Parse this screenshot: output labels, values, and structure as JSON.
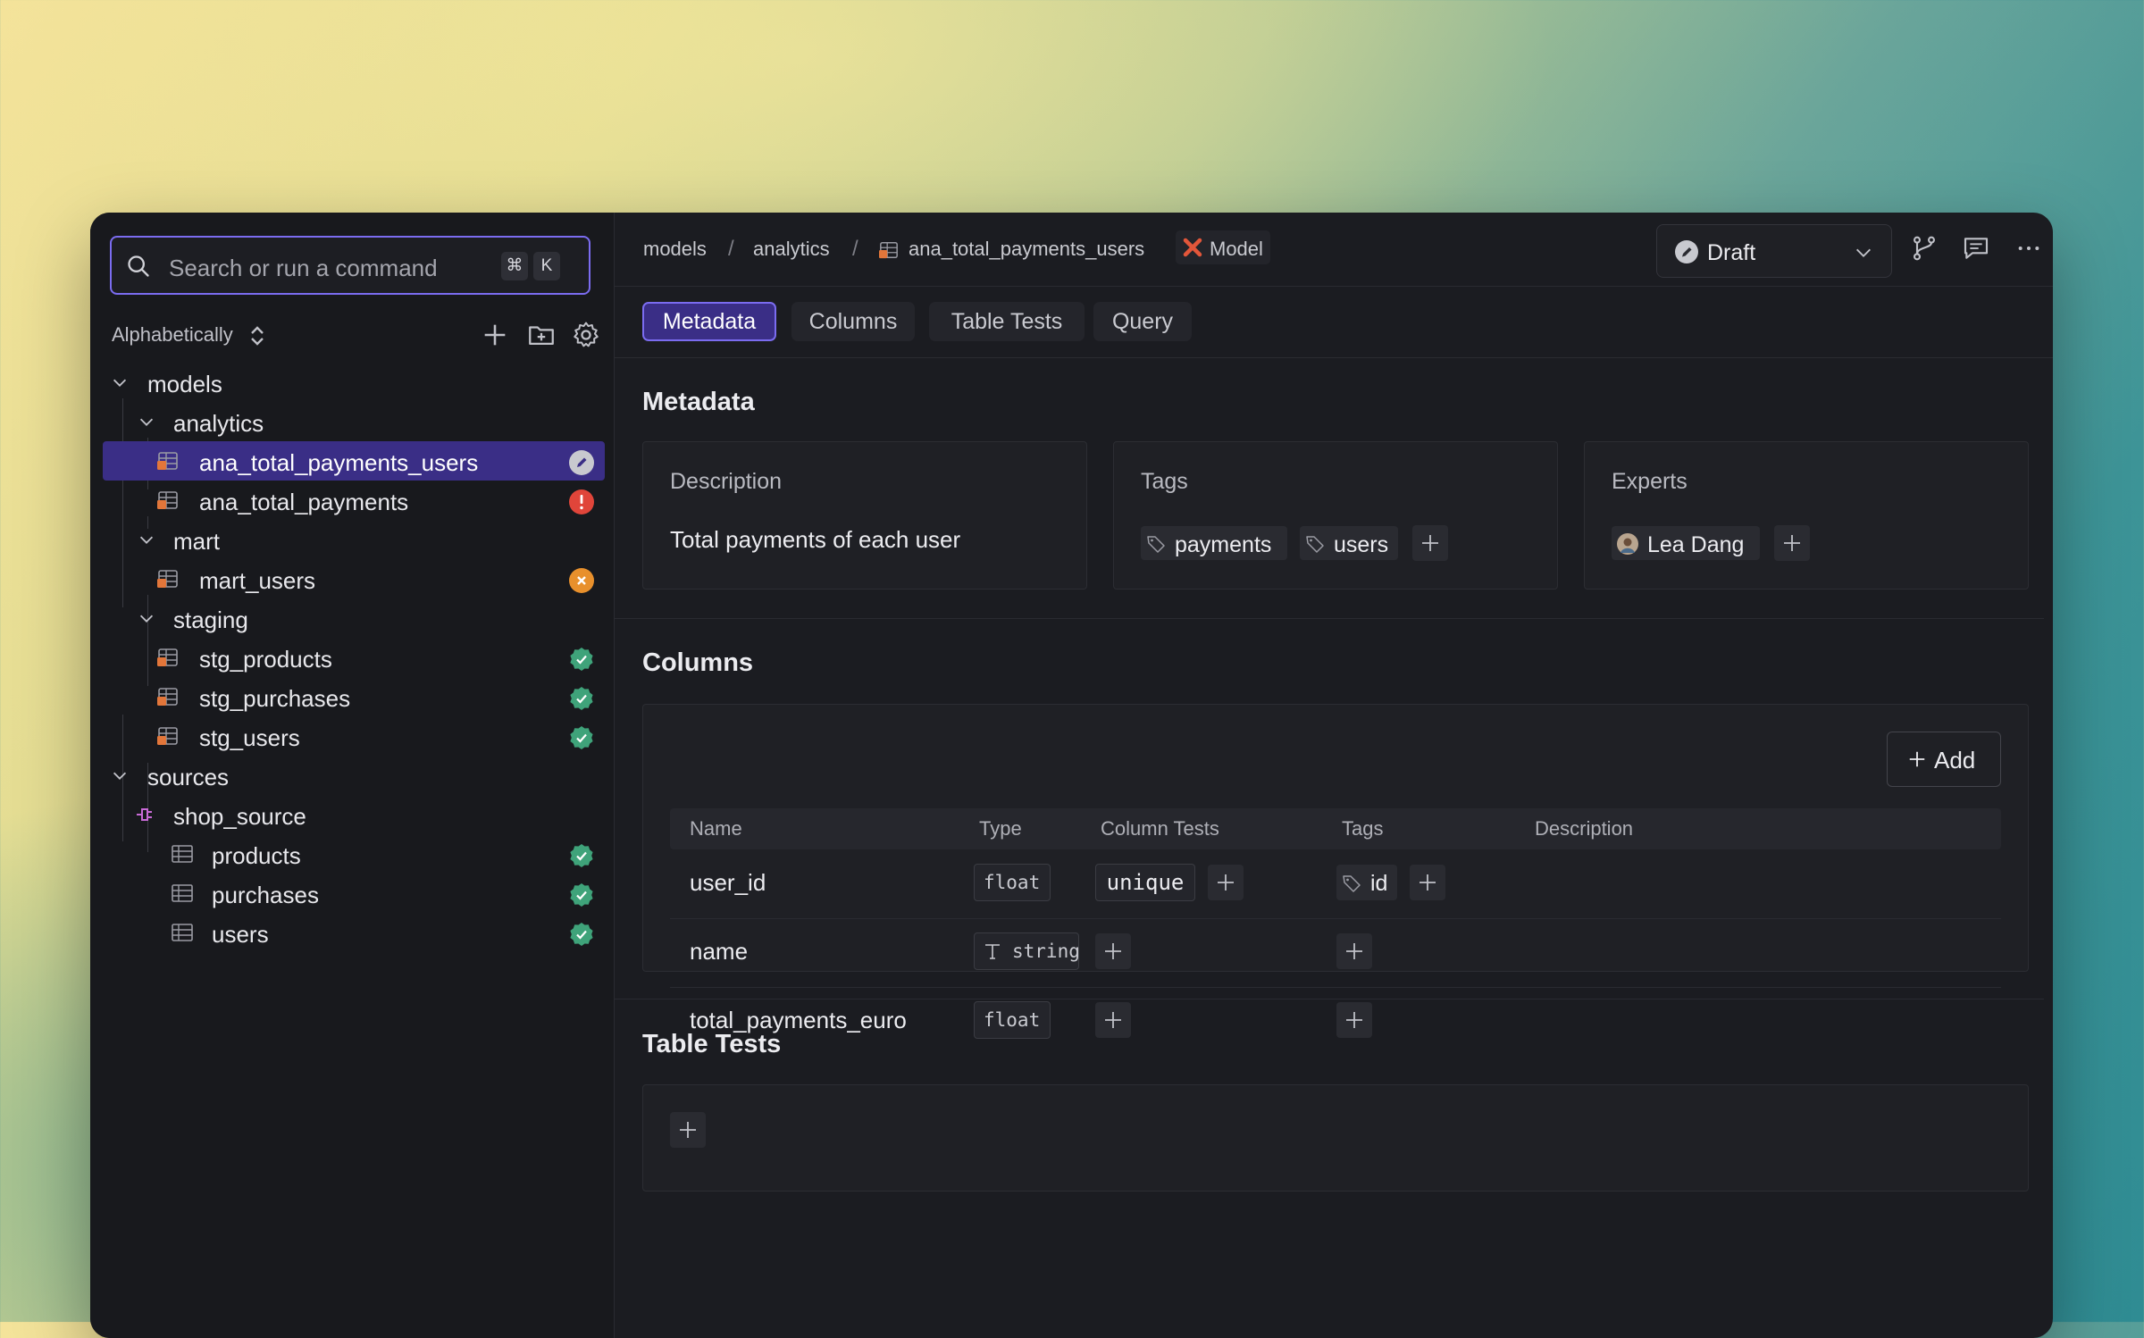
{
  "sidebar": {
    "search_placeholder": "Search or run a command",
    "shortcut_keys": [
      "⌘",
      "K"
    ],
    "sort_label": "Alphabetically",
    "tree": [
      {
        "label": "models",
        "kind": "folder"
      },
      {
        "label": "analytics",
        "kind": "folder"
      },
      {
        "label": "ana_total_payments_users",
        "kind": "model",
        "status": "editing",
        "selected": true
      },
      {
        "label": "ana_total_payments",
        "kind": "model",
        "status": "error"
      },
      {
        "label": "mart",
        "kind": "folder"
      },
      {
        "label": "mart_users",
        "kind": "model",
        "status": "warning"
      },
      {
        "label": "staging",
        "kind": "folder"
      },
      {
        "label": "stg_products",
        "kind": "model",
        "status": "success"
      },
      {
        "label": "stg_purchases",
        "kind": "model",
        "status": "success"
      },
      {
        "label": "stg_users",
        "kind": "model",
        "status": "success"
      },
      {
        "label": "sources",
        "kind": "folder"
      },
      {
        "label": "shop_source",
        "kind": "source"
      },
      {
        "label": "products",
        "kind": "table",
        "status": "success"
      },
      {
        "label": "purchases",
        "kind": "table",
        "status": "success"
      },
      {
        "label": "users",
        "kind": "table",
        "status": "success"
      }
    ]
  },
  "header": {
    "breadcrumb": [
      "models",
      "analytics",
      "ana_total_payments_users"
    ],
    "model_label": "Model",
    "draft_label": "Draft"
  },
  "tabs": [
    "Metadata",
    "Columns",
    "Table Tests",
    "Query"
  ],
  "metadata": {
    "title": "Metadata",
    "description_heading": "Description",
    "description_text": "Total payments of each user",
    "tags_heading": "Tags",
    "tags": [
      "payments",
      "users"
    ],
    "experts_heading": "Experts",
    "experts": [
      "Lea Dang"
    ]
  },
  "columns": {
    "title": "Columns",
    "add_label": "Add",
    "headers": [
      "Name",
      "Type",
      "Column Tests",
      "Tags",
      "Description"
    ],
    "rows": [
      {
        "name": "user_id",
        "type": "float",
        "tests": [
          "unique"
        ],
        "tags": [
          "id"
        ]
      },
      {
        "name": "name",
        "type": "string",
        "tests": [],
        "tags": []
      },
      {
        "name": "total_payments_euro",
        "type": "float",
        "tests": [],
        "tags": []
      }
    ]
  },
  "table_tests": {
    "title": "Table Tests"
  },
  "colors": {
    "accent": "#7b6cf0",
    "selected_bg": "#3a2e86",
    "success": "#3fa37a",
    "error": "#e0453a",
    "warning": "#e8902c",
    "model_icon": "#e2763a"
  }
}
